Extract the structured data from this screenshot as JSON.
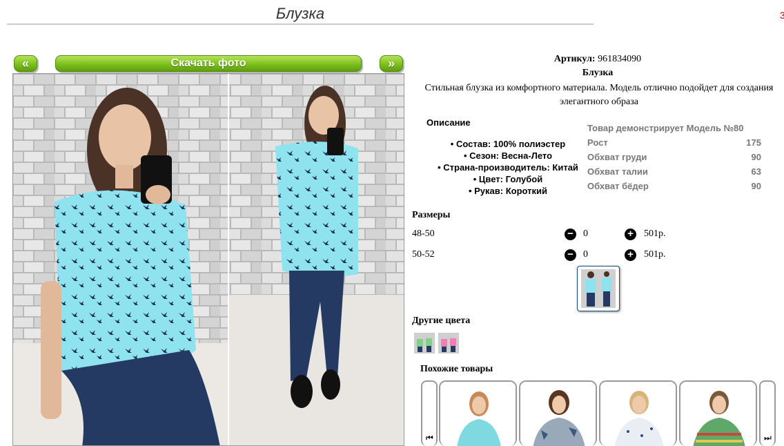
{
  "page": {
    "title": "Блузка",
    "edge_mark": "3"
  },
  "gallery": {
    "prev_label": "«",
    "download_label": "Скачать фото",
    "next_label": "»"
  },
  "product": {
    "article_label": "Артикул:",
    "article_value": "961834090",
    "name": "Блузка",
    "description": "Стильная блузка из комфортного материала. Модель отлично подойдет для создания элегантного образа"
  },
  "description_block": {
    "title": "Описание",
    "items": [
      "Состав: 100% полиэстер",
      "Сезон: Весна-Лето",
      "Страна-производитель: Китай",
      "Цвет: Голубой",
      "Рукав: Короткий"
    ]
  },
  "model": {
    "heading": "Товар демонстрирует Модель №80",
    "rows": [
      {
        "label": "Рост",
        "value": "175"
      },
      {
        "label": "Обхват груди",
        "value": "90"
      },
      {
        "label": "Обхват талии",
        "value": "63"
      },
      {
        "label": "Обхват бёдер",
        "value": "90"
      }
    ]
  },
  "sizes": {
    "title": "Размеры",
    "rows": [
      {
        "size": "48-50",
        "qty": "0",
        "price": "501р."
      },
      {
        "size": "50-52",
        "qty": "0",
        "price": "501р."
      }
    ]
  },
  "other_colors": {
    "title": "Другие цвета"
  },
  "similar": {
    "title": "Похожие товары"
  },
  "colors": {
    "accent_green": "#7cc01c",
    "blouse_blue": "#8ee3ee",
    "text_gray": "#777777"
  },
  "icons": {
    "minus": "minus-circle-icon",
    "plus": "plus-circle-icon",
    "carousel_prev": "first-page-icon",
    "carousel_next": "last-page-icon"
  }
}
